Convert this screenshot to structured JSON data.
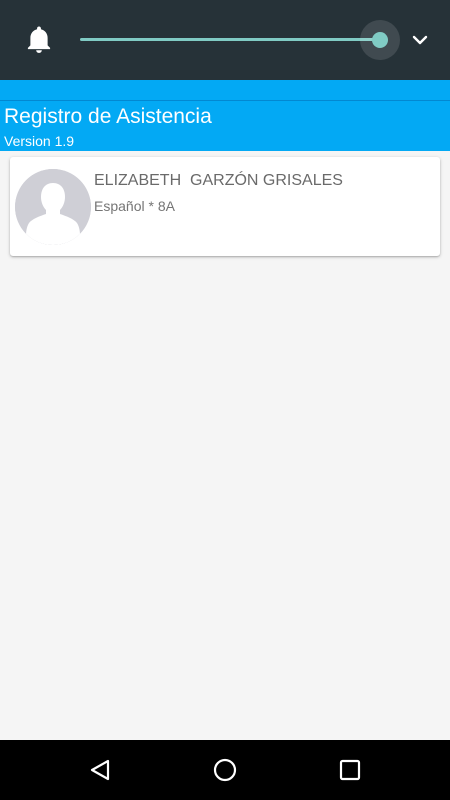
{
  "system": {
    "brightness_level": 1.0,
    "icons": [
      "bell-icon",
      "chevron-down-icon",
      "back-icon",
      "home-icon",
      "recents-icon"
    ]
  },
  "app": {
    "title": "Registro de Asistencia",
    "version": "Version 1.9",
    "accent_color": "#03a9f4"
  },
  "students": [
    {
      "name": "ELIZABETH  GARZÓN GRISALES",
      "course": "Español * 8A",
      "avatar": "default-person-avatar"
    }
  ]
}
